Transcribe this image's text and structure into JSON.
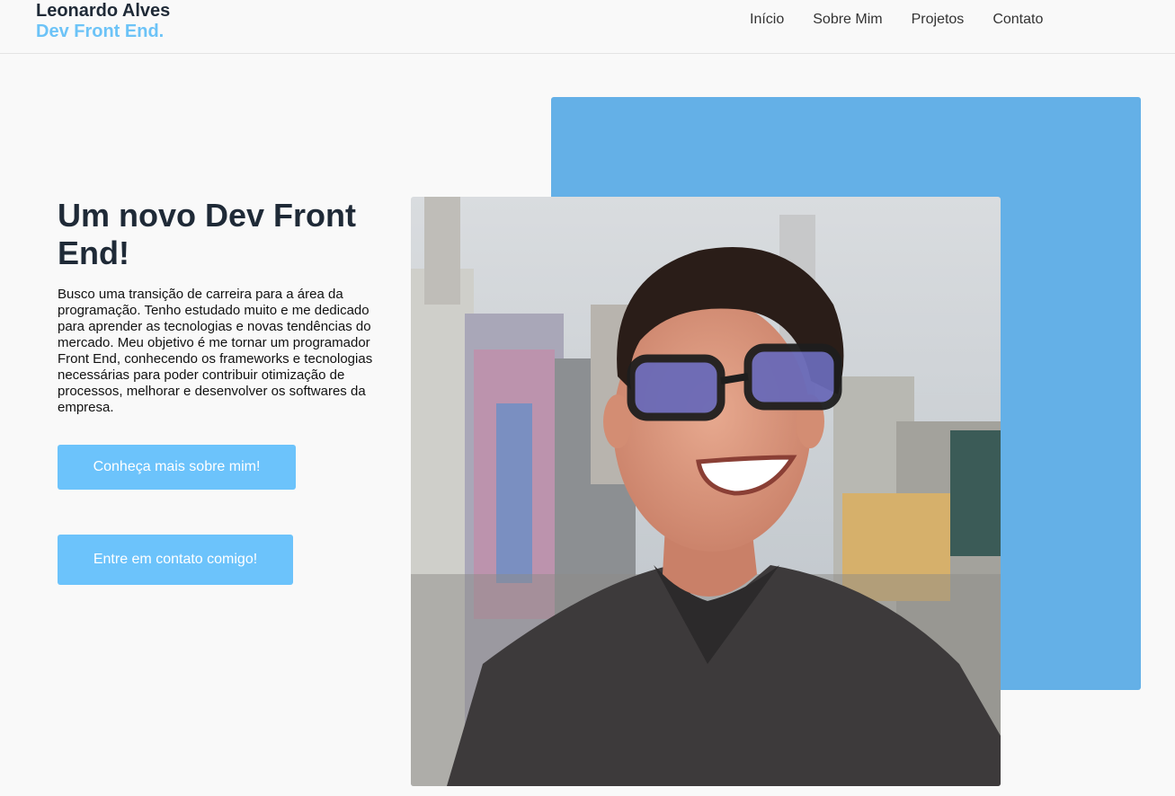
{
  "header": {
    "name": "Leonardo Alves",
    "role": "Dev Front End.",
    "nav": [
      {
        "label": "Início"
      },
      {
        "label": "Sobre Mim"
      },
      {
        "label": "Projetos"
      },
      {
        "label": "Contato"
      }
    ]
  },
  "hero": {
    "title": "Um novo Dev Front End!",
    "description": "Busco uma transição de carreira para a área da programação. Tenho estudado muito e me dedicado para aprender as tecnologias e novas tendências do mercado. Meu objetivo é me tornar um programador Front End, conhecendo os frameworks e tecnologias necessárias para poder contribuir otimização de processos, melhorar e desenvolver os softwares da empresa.",
    "about_button": "Conheça mais sobre mim!",
    "contact_button": "Entre em contato comigo!"
  },
  "colors": {
    "accent": "#6cc3fb",
    "block": "#64b0e7",
    "heading": "#1f2a37"
  }
}
